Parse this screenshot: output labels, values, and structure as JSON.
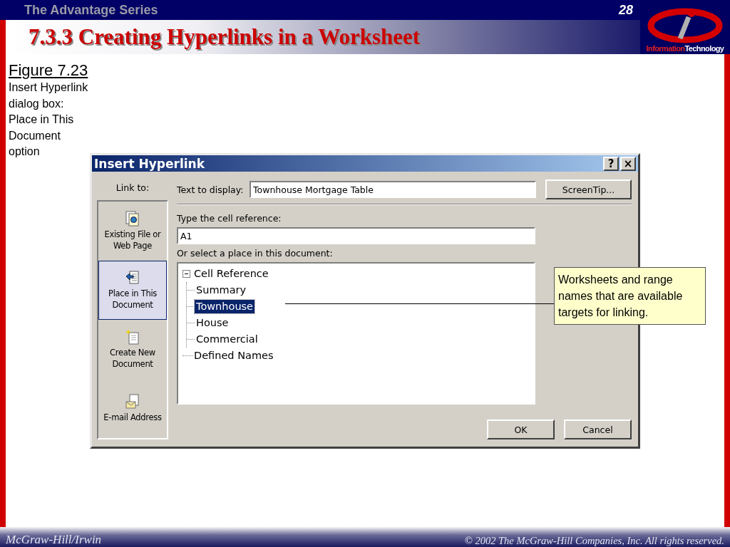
{
  "header": {
    "series": "The Advantage Series",
    "page_number": "28",
    "title": "7.3.3 Creating Hyperlinks in a Worksheet",
    "logo": {
      "part_1": "Information",
      "part_2": "Technology"
    }
  },
  "caption": {
    "figure": "Figure 7.23",
    "text": "Insert Hyperlink dialog box: Place in This Document option"
  },
  "dialog": {
    "title": "Insert Hyperlink",
    "title_buttons": [
      "?",
      "×"
    ],
    "link_to_label": "Link to:",
    "link_to_items": [
      {
        "kind": "file",
        "label": "Existing File or Web Page",
        "selected": false
      },
      {
        "kind": "place",
        "label": "Place in This Document",
        "selected": true
      },
      {
        "kind": "new",
        "label": "Create New Document",
        "selected": false
      },
      {
        "kind": "email",
        "label": "E-mail Address",
        "selected": false
      }
    ],
    "text_to_display": {
      "label": "Text to display:",
      "value": "Townhouse Mortgage Table"
    },
    "screentip_button": "ScreenTip...",
    "cell_reference": {
      "label": "Type the cell reference:",
      "value": "A1"
    },
    "place_label": "Or select a place in this document:",
    "tree": [
      {
        "label": "Cell Reference",
        "expanded": true,
        "selected": false,
        "children": [
          {
            "label": "Summary",
            "selected": false
          },
          {
            "label": "Townhouse",
            "selected": true
          },
          {
            "label": "House",
            "selected": false
          },
          {
            "label": "Commercial",
            "selected": false
          }
        ]
      },
      {
        "label": "Defined Names",
        "selected": false
      }
    ],
    "buttons": [
      "OK",
      "Cancel"
    ]
  },
  "callout": "Worksheets and range names that are available targets for linking.",
  "footer": {
    "publisher": "McGraw-Hill/Irwin",
    "copyright": "© 2002  The McGraw-Hill Companies, Inc. All rights reserved."
  }
}
